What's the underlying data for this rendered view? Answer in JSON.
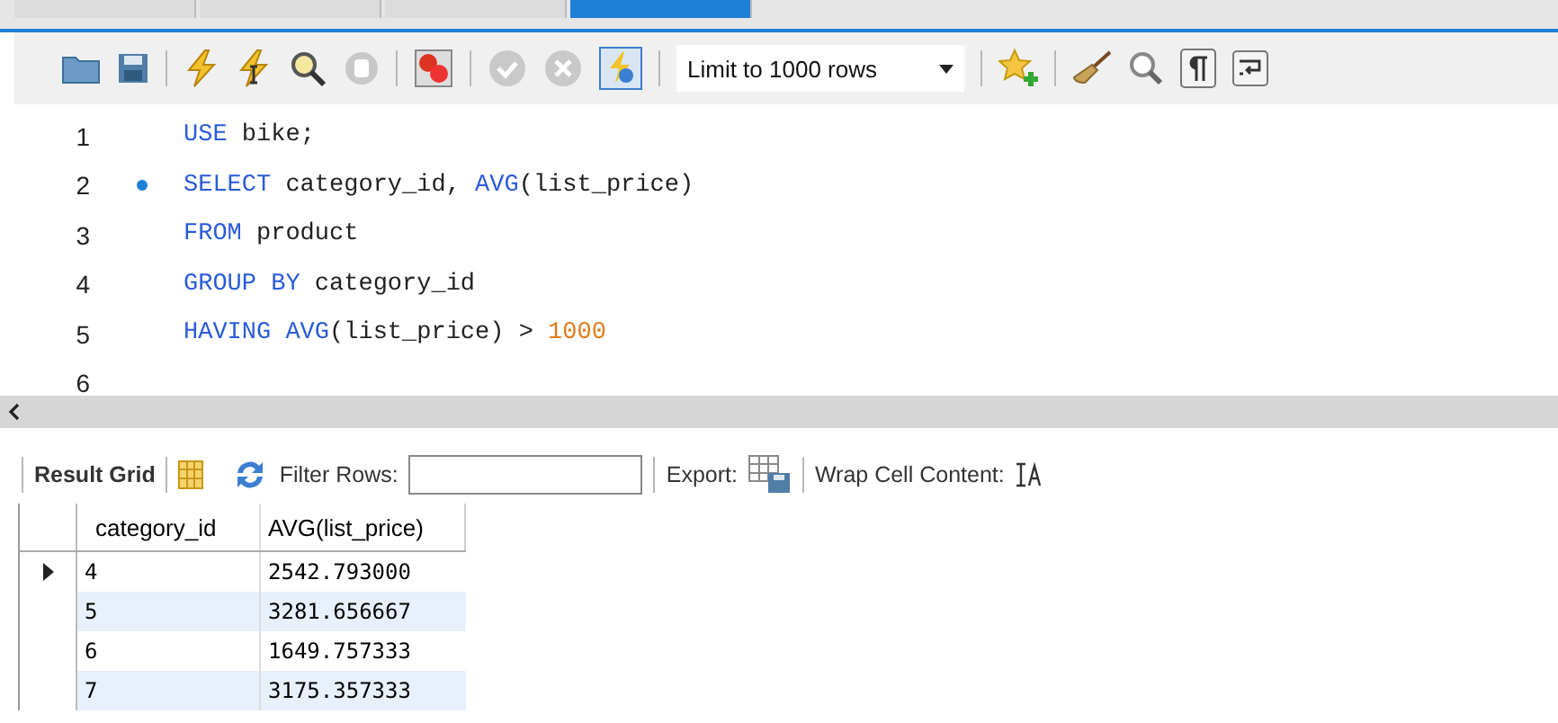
{
  "tabs": [
    {
      "selected": false
    },
    {
      "selected": false
    },
    {
      "selected": false
    },
    {
      "selected": true
    }
  ],
  "toolbar": {
    "limit_select": "Limit to 1000 rows",
    "autocommit_on": true
  },
  "editor": {
    "lines": [
      {
        "number": "1",
        "marker": false,
        "tokens": [
          {
            "kind": "keyword",
            "text": "USE"
          },
          {
            "kind": "plain",
            "text": " bike;"
          }
        ]
      },
      {
        "number": "2",
        "marker": true,
        "tokens": [
          {
            "kind": "keyword",
            "text": "SELECT"
          },
          {
            "kind": "plain",
            "text": " category_id, "
          },
          {
            "kind": "keyword",
            "text": "AVG"
          },
          {
            "kind": "plain",
            "text": "(list_price)"
          }
        ]
      },
      {
        "number": "3",
        "marker": false,
        "tokens": [
          {
            "kind": "keyword",
            "text": "FROM"
          },
          {
            "kind": "plain",
            "text": " product"
          }
        ]
      },
      {
        "number": "4",
        "marker": false,
        "tokens": [
          {
            "kind": "keyword",
            "text": "GROUP BY"
          },
          {
            "kind": "plain",
            "text": " category_id"
          }
        ]
      },
      {
        "number": "5",
        "marker": false,
        "tokens": [
          {
            "kind": "keyword",
            "text": "HAVING"
          },
          {
            "kind": "keyword",
            "text": " AVG"
          },
          {
            "kind": "plain",
            "text": "(list_price) > "
          },
          {
            "kind": "number",
            "text": "1000"
          }
        ]
      },
      {
        "number": "6",
        "marker": false
      }
    ]
  },
  "result_toolbar": {
    "result_grid": "Result Grid",
    "filter_label": "Filter Rows:",
    "export_label": "Export:",
    "wrap_label": "Wrap Cell Content:"
  },
  "table": {
    "columns": [
      "category_id",
      "AVG(list_price)"
    ],
    "rows": [
      {
        "selected": true,
        "cells": [
          "4",
          "2542.793000"
        ]
      },
      {
        "selected": false,
        "cells": [
          "5",
          "3281.656667"
        ]
      },
      {
        "selected": false,
        "cells": [
          "6",
          "1649.757333"
        ]
      },
      {
        "selected": false,
        "cells": [
          "7",
          "3175.357333"
        ]
      }
    ]
  }
}
